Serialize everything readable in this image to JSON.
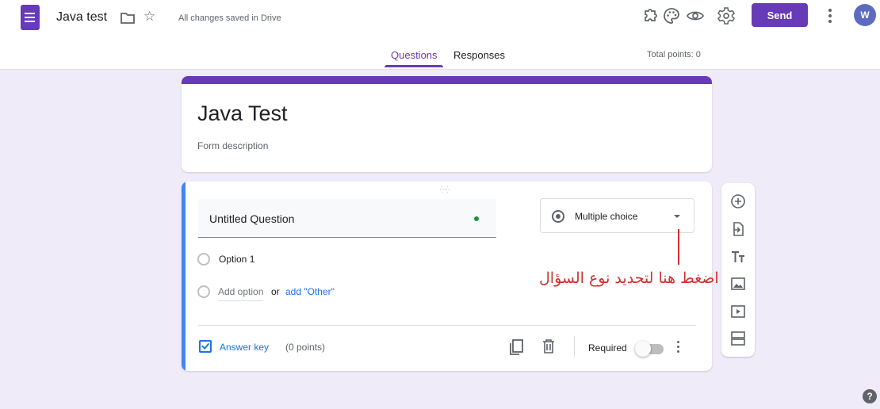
{
  "header": {
    "doc_title": "Java test",
    "saved_status": "All changes saved in Drive",
    "send_label": "Send",
    "avatar_initial": "W",
    "icons": [
      "forms-app-icon",
      "folder-icon",
      "star-icon",
      "addon-icon",
      "palette-icon",
      "preview-eye-icon",
      "settings-gear-icon",
      "more-vert-icon"
    ]
  },
  "tabs": {
    "questions": "Questions",
    "responses": "Responses",
    "active": "Questions"
  },
  "total_points": "Total points: 0",
  "form": {
    "title": "Java Test",
    "description": "Form description"
  },
  "question": {
    "title": "Untitled Question",
    "type": "Multiple choice",
    "options": [
      "Option 1"
    ],
    "add_option": "Add option",
    "or": "or",
    "add_other": "add \"Other\"",
    "answer_key": "Answer key",
    "points": "(0 points)",
    "required_label": "Required",
    "required": false
  },
  "side_toolbar": [
    "add-question-icon",
    "import-questions-icon",
    "add-title-icon",
    "add-image-icon",
    "add-video-icon",
    "add-section-icon"
  ],
  "annotation": {
    "text": "اضغط هنا لتحديد نوع السؤال"
  },
  "colors": {
    "accent": "#673ab7",
    "question_accent": "#4285f4",
    "link": "#1a73e8",
    "annotation": "#d32f2f",
    "background": "#f0ebf8"
  }
}
